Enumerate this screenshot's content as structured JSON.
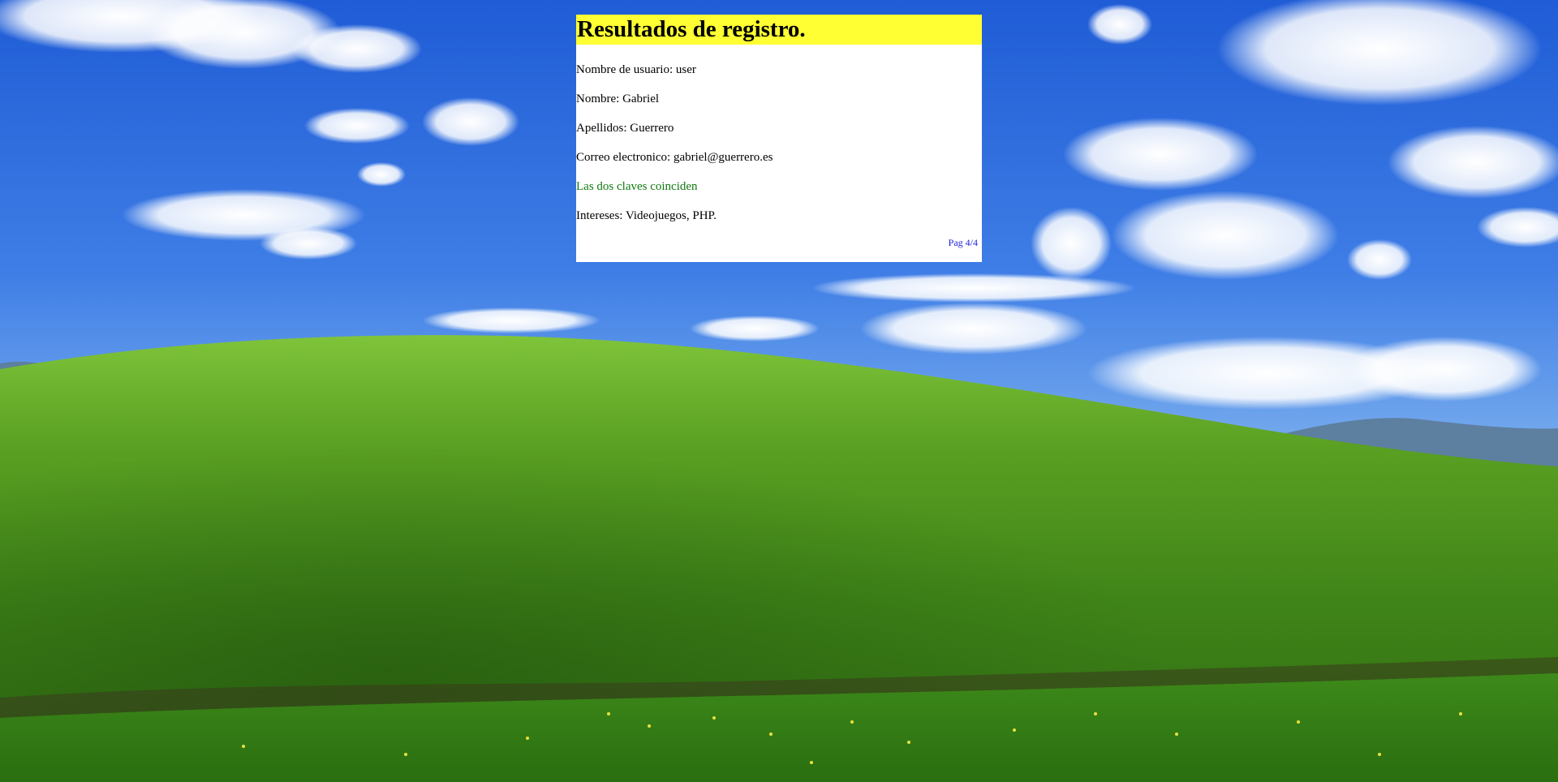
{
  "results": {
    "title": "Resultados de registro.",
    "username_line": "Nombre de usuario: user",
    "name_line": "Nombre: Gabriel",
    "surname_line": "Apellidos: Guerrero",
    "email_line": "Correo electronico: gabriel@guerrero.es",
    "password_match_line": "Las dos claves coinciden",
    "interests_line": "Intereses: Videojuegos, PHP.",
    "page_indicator": "Pag 4/4"
  },
  "colors": {
    "title_background": "#ffff33",
    "panel_background": "#ffffff",
    "success_text": "#0f7a0f",
    "link_text": "#1d1de0"
  },
  "background": {
    "description_icon": "landscape-wallpaper"
  }
}
